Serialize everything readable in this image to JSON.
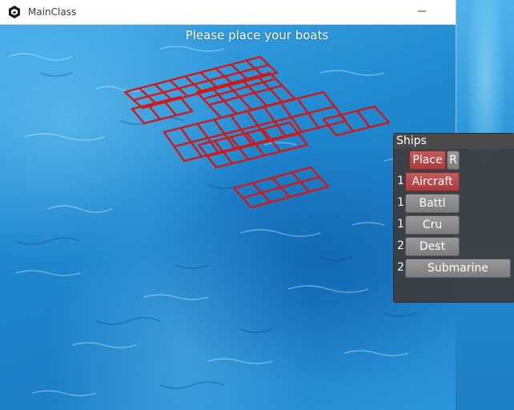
{
  "window": {
    "title": "MainClass",
    "icon": "app-icon"
  },
  "scene": {
    "prompt": "Please place your boats"
  },
  "ships_panel": {
    "title": "Ships",
    "mode_buttons": [
      {
        "label": "Place"
      },
      {
        "label": "R"
      }
    ],
    "ships": [
      {
        "count": "1",
        "label": "Aircraft"
      },
      {
        "count": "1",
        "label": "Battl"
      },
      {
        "count": "1",
        "label": "Cru"
      },
      {
        "count": "2",
        "label": "Dest"
      },
      {
        "count": "2",
        "label": "Submarine"
      }
    ]
  },
  "colors": {
    "grid_line": "#d01818",
    "selected_button": "#b14646",
    "ship_button": "#8b8b8b"
  }
}
